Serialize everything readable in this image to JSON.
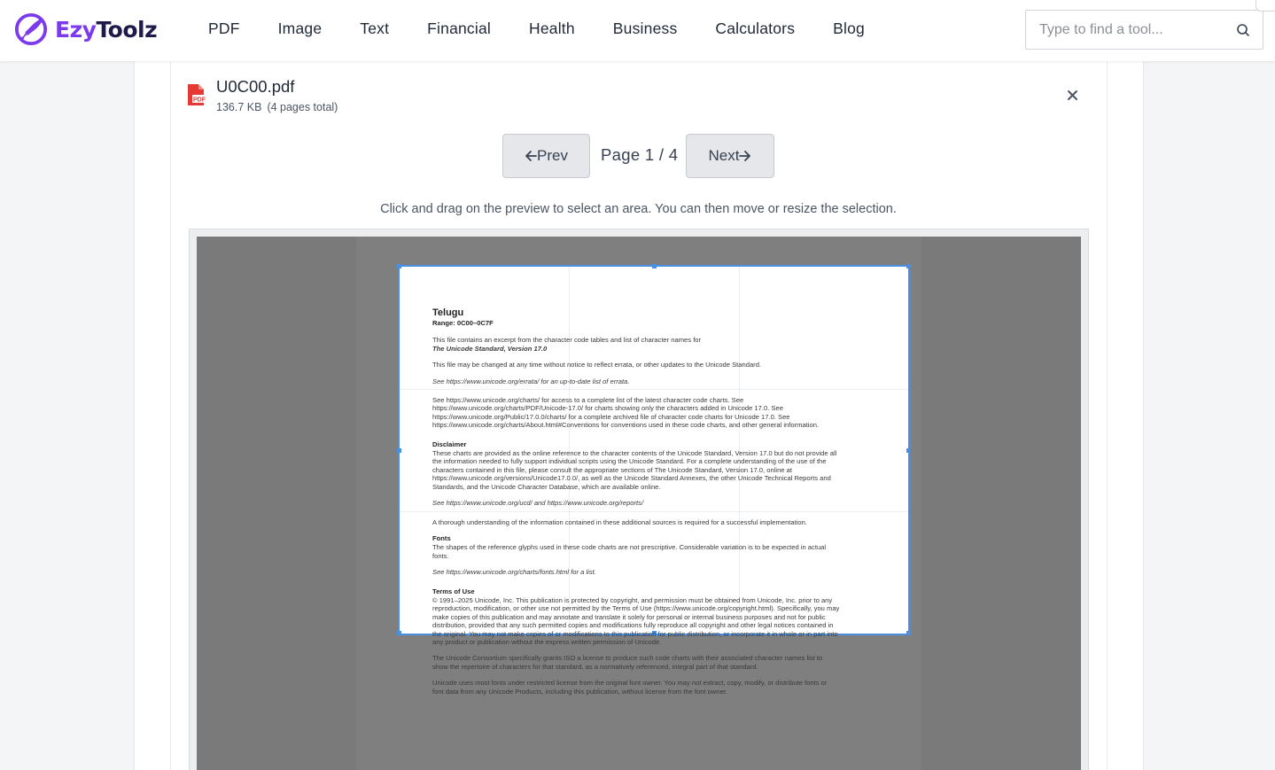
{
  "header": {
    "logo": {
      "part1": "Ezy",
      "part2": "Toolz"
    },
    "nav": [
      "PDF",
      "Image",
      "Text",
      "Financial",
      "Health",
      "Business",
      "Calculators",
      "Blog"
    ],
    "search": {
      "placeholder": "Type to find a tool...",
      "value": ""
    }
  },
  "file": {
    "name": "U0C00.pdf",
    "size": "136.7 KB",
    "pages": "(4 pages total)"
  },
  "pager": {
    "prev_label": "Prev",
    "next_label": "Next",
    "indicator": "Page 1 / 4"
  },
  "hint": "Click and drag on the preview to select an area. You can then move or resize the selection.",
  "pdf": {
    "title": "Telugu",
    "range": "Range: 0C00–0C7F",
    "p1a": "This file contains an excerpt from the character code tables and list of character names for",
    "p1b": "The Unicode Standard, Version 17.0",
    "p2": "This file may be changed at any time without notice to reflect errata, or other updates to the Unicode Standard.",
    "p3": "See https://www.unicode.org/errata/ for an up-to-date list of errata.",
    "p4": "See https://www.unicode.org/charts/ for access to a complete list of the latest character code charts. See https://www.unicode.org/charts/PDF/Unicode-17.0/ for charts showing only the characters added in Unicode 17.0. See https://www.unicode.org/Public/17.0.0/charts/ for a complete archived file of character code charts for Unicode 17.0. See https://www.unicode.org/charts/About.html#Conventions for conventions used in these code charts, and other general information.",
    "disclaimer_heading": "Disclaimer",
    "disclaimer": "These charts are provided as the online reference to the character contents of the Unicode Standard, Version 17.0 but do not provide all the information needed to fully support individual scripts using the Unicode Standard. For a complete understanding of the use of the characters contained in this file, please consult the appropriate sections of The Unicode Standard, Version 17.0, online at https://www.unicode.org/versions/Unicode17.0.0/, as well as the Unicode Standard Annexes, the other Unicode Technical Reports and Standards, and the Unicode Character Database, which are available online.",
    "p5": "See https://www.unicode.org/ucd/ and https://www.unicode.org/reports/",
    "p6": "A thorough understanding of the information contained in these additional sources is required for a successful implementation.",
    "fonts_heading": "Fonts",
    "fonts": "The shapes of the reference glyphs used in these code charts are not prescriptive. Considerable variation is to be expected in actual fonts.",
    "p7": "See https://www.unicode.org/charts/fonts.html for a list.",
    "terms_heading": "Terms of Use",
    "terms": "© 1991–2025 Unicode, Inc. This publication is protected by copyright, and permission must be obtained from Unicode, Inc. prior to any reproduction, modification, or other use not permitted by the Terms of Use (https://www.unicode.org/copyright.html). Specifically, you may make copies of this publication and may annotate and translate it solely for personal or internal business purposes and not for public distribution, provided that any such permitted copies and modifications fully reproduce all copyright and other legal notices contained in the original. You may not make copies of or modifications to this publication for public distribution, or incorporate it in whole or in part into any product or publication without the express written permission of Unicode.",
    "consortium": "The Unicode Consortium specifically grants ISO a license to produce such code charts with their associated character names list to show the repertoire of characters for that standard, as a normatively referenced, integral part of that standard.",
    "fonts_license": "Unicode uses most fonts under restricted license from the original font owner. You may not extract, copy, modify, or distribute fonts or font data from any Unicode Products, including this publication, without license from the font owner."
  },
  "colors": {
    "accent": "#7c3aed",
    "selection": "#4a90e2",
    "pdf_icon": "#e53935"
  },
  "icons": {
    "search": "search-icon",
    "close": "close-icon",
    "file": "pdf-file-icon"
  }
}
